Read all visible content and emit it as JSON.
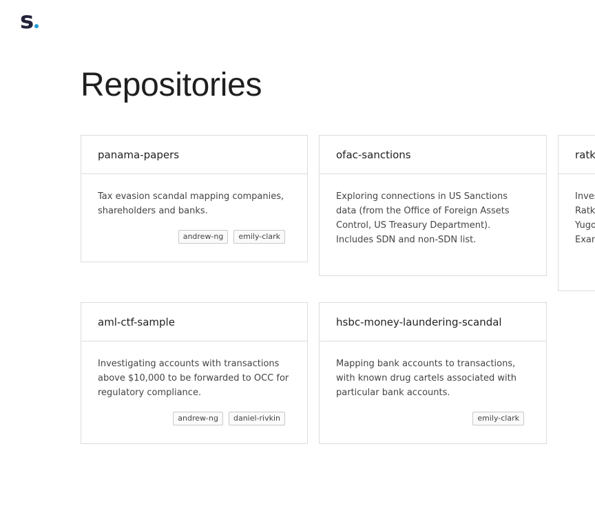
{
  "logo": {
    "text": "s",
    "dot_color": "#1e9bd7"
  },
  "page": {
    "title": "Repositories"
  },
  "repos": [
    {
      "name": "panama-papers",
      "description": "Tax evasion scandal mapping companies, shareholders and banks.",
      "tags": [
        "andrew-ng",
        "emily-clark"
      ]
    },
    {
      "name": "ofac-sanctions",
      "description": "Exploring connections in US Sanctions data (from the Office of Foreign Assets Control, US Treasury Department). Includes SDN and non-SDN list.",
      "tags": []
    },
    {
      "name": "ratko",
      "description": "Inves Ratko Yugo Exam",
      "tags": []
    },
    {
      "name": "aml-ctf-sample",
      "description": "Investigating accounts with transactions above $10,000 to be forwarded to OCC for regulatory compliance.",
      "tags": [
        "andrew-ng",
        "daniel-rivkin"
      ]
    },
    {
      "name": "hsbc-money-laundering-scandal",
      "description": "Mapping bank accounts to transactions, with known drug cartels associated with particular bank accounts.",
      "tags": [
        "emily-clark"
      ]
    }
  ]
}
